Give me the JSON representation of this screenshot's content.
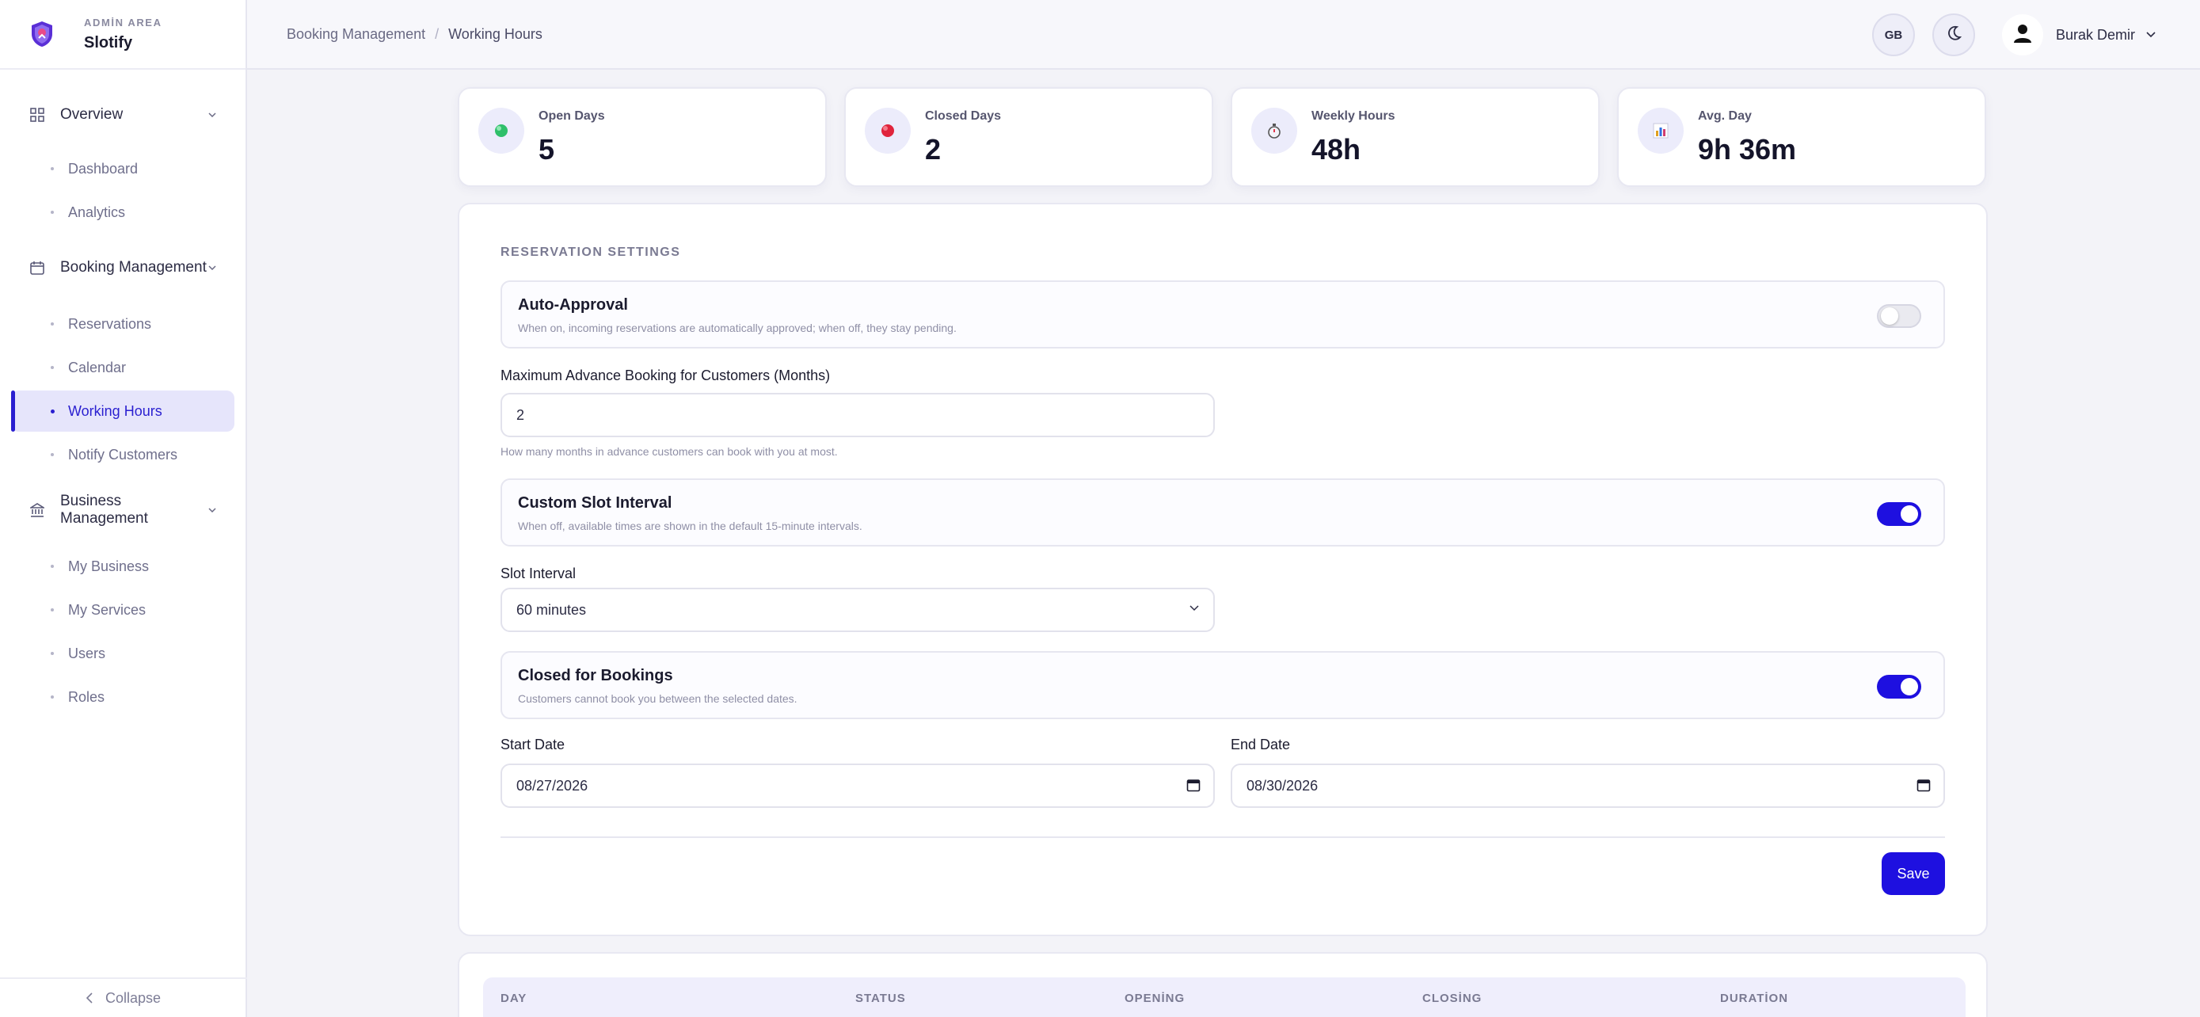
{
  "brand": {
    "area": "ADMİN AREA",
    "name": "Slotify"
  },
  "sidebar": {
    "groups": [
      {
        "label": "Overview",
        "items": [
          "Dashboard",
          "Analytics"
        ]
      },
      {
        "label": "Booking Management",
        "items": [
          "Reservations",
          "Calendar",
          "Working Hours",
          "Notify Customers"
        ]
      },
      {
        "label": "Business Management",
        "items": [
          "My Business",
          "My Services",
          "Users",
          "Roles"
        ]
      }
    ],
    "active_item": "Working Hours",
    "collapse_label": "Collapse"
  },
  "topbar": {
    "breadcrumb": [
      "Booking Management",
      "Working Hours"
    ],
    "language": "GB",
    "user_name": "Burak Demir"
  },
  "stats": [
    {
      "label": "Open Days",
      "value": "5",
      "icon": "green-dot-icon"
    },
    {
      "label": "Closed Days",
      "value": "2",
      "icon": "red-dot-icon"
    },
    {
      "label": "Weekly Hours",
      "value": "48h",
      "icon": "stopwatch-icon"
    },
    {
      "label": "Avg. Day",
      "value": "9h 36m",
      "icon": "bar-chart-icon"
    }
  ],
  "settings": {
    "section_title": "RESERVATION SETTINGS",
    "auto_approval": {
      "title": "Auto-Approval",
      "description": "When on, incoming reservations are automatically approved; when off, they stay pending.",
      "enabled": false
    },
    "max_advance": {
      "label": "Maximum Advance Booking for Customers (Months)",
      "value": "2",
      "hint": "How many months in advance customers can book with you at most."
    },
    "custom_slot": {
      "title": "Custom Slot Interval",
      "description": "When off, available times are shown in the default 15-minute intervals.",
      "enabled": true
    },
    "slot_interval": {
      "label": "Slot Interval",
      "value": "60 minutes"
    },
    "closed_for_bookings": {
      "title": "Closed for Bookings",
      "description": "Customers cannot book you between the selected dates.",
      "enabled": true
    },
    "start_date": {
      "label": "Start Date",
      "value": "08/27/2026"
    },
    "end_date": {
      "label": "End Date",
      "value": "08/30/2026"
    },
    "save_label": "Save"
  },
  "table": {
    "headers": [
      "DAY",
      "STATUS",
      "OPENİNG",
      "CLOSİNG",
      "DURATİON"
    ]
  },
  "colors": {
    "accent": "#1e10e0",
    "active_bg": "#e6e5fb"
  }
}
